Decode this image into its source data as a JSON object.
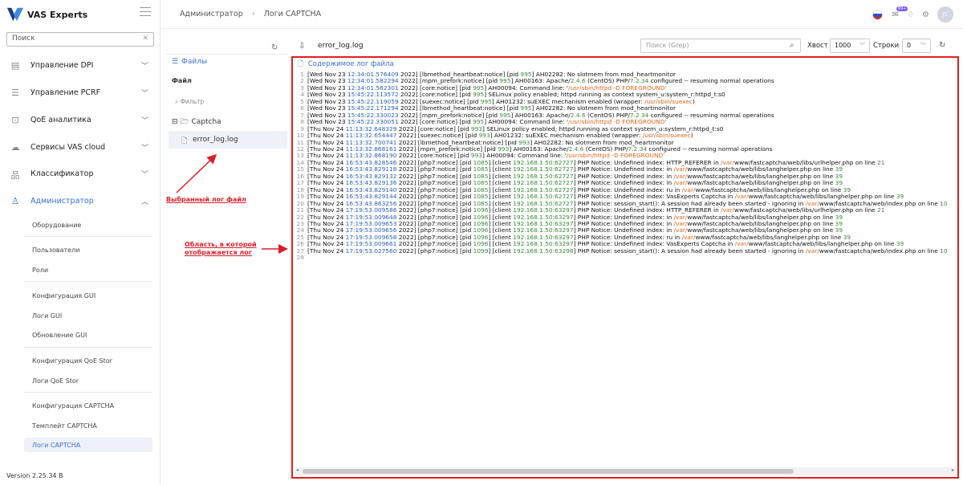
{
  "brand": {
    "name": "VAS Experts"
  },
  "search": {
    "placeholder": "Поиск"
  },
  "sidebar": {
    "items": [
      {
        "label": "Управление DPI"
      },
      {
        "label": "Управление PCRF"
      },
      {
        "label": "QoE аналитика"
      },
      {
        "label": "Сервисы VAS cloud"
      },
      {
        "label": "Классификатор"
      },
      {
        "label": "Администратор"
      }
    ],
    "admin_sub": [
      {
        "label": "Оборудование"
      },
      {
        "label": "Пользователи"
      },
      {
        "label": "Роли"
      },
      {
        "label": "Конфигурация GUI"
      },
      {
        "label": "Логи GUI"
      },
      {
        "label": "Обновление GUI"
      },
      {
        "label": "Конфигурация QoE Stor"
      },
      {
        "label": "Логи QoE Stor"
      },
      {
        "label": "Конфигурация CAPTCHA"
      },
      {
        "label": "Темплейт CAPTCHA"
      },
      {
        "label": "Логи CAPTCHA"
      }
    ],
    "version": "Version 2.25.34 B"
  },
  "header": {
    "breadcrumb": [
      "Администратор",
      "Логи CAPTCHA"
    ],
    "notif_badge": "99+",
    "avatar": "JS",
    "accent": "#3b6fd6"
  },
  "files": {
    "title": "Файлы",
    "file_label": "Файл",
    "filter_placeholder": "Фильтр",
    "folder": "Captcha",
    "file": "error_log.log"
  },
  "annotations": {
    "selected": "Выбранный лог файл",
    "area": "Область, в которой отображается лог"
  },
  "toolbar": {
    "filename": "error_log.log",
    "grep_placeholder": "Поиск (Grep)",
    "tail_label": "Хвост",
    "tail_value": "1000",
    "rows_label": "Строки",
    "rows_value": "0"
  },
  "log": {
    "title": "Содержимое лог файла",
    "lines": [
      "[Wed Nov 23 12:34:01.576409 2022] [lbmethod_heartbeat:notice] [pid 995] AH02282: No slotmem from mod_heartmonitor",
      "[Wed Nov 23 12:34:01.582294 2022] [mpm_prefork:notice] [pid 995] AH00163: Apache/2.4.6 (CentOS) PHP/7.2.34 configured -- resuming normal operations",
      "[Wed Nov 23 12:34:01.582301 2022] [core:notice] [pid 995] AH00094: Command line: '/usr/sbin/httpd -D FOREGROUND'",
      "[Wed Nov 23 15:45:22.113572 2022] [core:notice] [pid 995] SELinux policy enabled; httpd running as context system_u:system_r:httpd_t:s0",
      "[Wed Nov 23 15:45:22.119059 2022] [suexec:notice] [pid 995] AH01232: suEXEC mechanism enabled (wrapper: /usr/sbin/suexec)",
      "[Wed Nov 23 15:45:22.171294 2022] [lbmethod_heartbeat:notice] [pid 995] AH02282: No slotmem from mod_heartmonitor",
      "[Wed Nov 23 15:45:22.330023 2022] [mpm_prefork:notice] [pid 995] AH00163: Apache/2.4.6 (CentOS) PHP/7.2.34 configured -- resuming normal operations",
      "[Wed Nov 23 15:45:22.330051 2022] [core:notice] [pid 995] AH00094: Command line: '/usr/sbin/httpd -D FOREGROUND'",
      "[Thu Nov 24 11:13:32.648329 2022] [core:notice] [pid 993] SELinux policy enabled; httpd running as context system_u:system_r:httpd_t:s0",
      "[Thu Nov 24 11:13:32.654447 2022] [suexec:notice] [pid 993] AH01232: suEXEC mechanism enabled (wrapper: /usr/sbin/suexec)",
      "[Thu Nov 24 11:13:32.700741 2022] [lbmethod_heartbeat:notice] [pid 993] AH02282: No slotmem from mod_heartmonitor",
      "[Thu Nov 24 11:13:32.868161 2022] [mpm_prefork:notice] [pid 993] AH00163: Apache/2.4.6 (CentOS) PHP/7.2.34 configured -- resuming normal operations",
      "[Thu Nov 24 11:13:32.868190 2022] [core:notice] [pid 993] AH00094: Command line: '/usr/sbin/httpd -D FOREGROUND'",
      "[Thu Nov 24 16:53:43.828546 2022] [php7:notice] [pid 1085] [client 192.168.1.50:62727] PHP Notice:  Undefined index: HTTP_REFERER in /var/www/fastcaptcha/web/libs/urlhelper.php on line 21",
      "[Thu Nov 24 16:53:43.829118 2022] [php7:notice] [pid 1085] [client 192.168.1.50:62727] PHP Notice:  Undefined index:  in /var/www/fastcaptcha/web/libs/langhelper.php on line 39",
      "[Thu Nov 24 16:53:43.829132 2022] [php7:notice] [pid 1085] [client 192.168.1.50:62727] PHP Notice:  Undefined index:  in /var/www/fastcaptcha/web/libs/langhelper.php on line 39",
      "[Thu Nov 24 16:53:43.829136 2022] [php7:notice] [pid 1085] [client 192.168.1.50:62727] PHP Notice:  Undefined index:  in /var/www/fastcaptcha/web/libs/langhelper.php on line 39",
      "[Thu Nov 24 16:53:43.829140 2022] [php7:notice] [pid 1085] [client 192.168.1.50:62727] PHP Notice:  Undefined index: ru in /var/www/fastcaptcha/web/libs/langhelper.php on line 39",
      "[Thu Nov 24 16:53:43.829144 2022] [php7:notice] [pid 1085] [client 192.168.1.50:62727] PHP Notice:  Undefined index: VasExperts Captcha in /var/www/fastcaptcha/web/libs/langhelper.php on line 39",
      "[Thu Nov 24 16:53:43.863256 2022] [php7:notice] [pid 1085] [client 192.168.1.50:62727] PHP Notice:  session_start(): A session had already been started - ignoring in /var/www/fastcaptcha/web/index.php on line 10",
      "[Thu Nov 24 17:19:53.009586 2022] [php7:notice] [pid 1096] [client 192.168.1.50:63297] PHP Notice:  Undefined index: HTTP_REFERER in /var/www/fastcaptcha/web/libs/urlhelper.php on line 21",
      "[Thu Nov 24 17:19:53.009648 2022] [php7:notice] [pid 1096] [client 192.168.1.50:63297] PHP Notice:  Undefined index:  in /var/www/fastcaptcha/web/libs/langhelper.php on line 39",
      "[Thu Nov 24 17:19:53.009653 2022] [php7:notice] [pid 1096] [client 192.168.1.50:63297] PHP Notice:  Undefined index:  in /var/www/fastcaptcha/web/libs/langhelper.php on line 39",
      "[Thu Nov 24 17:19:53.009656 2022] [php7:notice] [pid 1096] [client 192.168.1.50:63297] PHP Notice:  Undefined index:  in /var/www/fastcaptcha/web/libs/langhelper.php on line 39",
      "[Thu Nov 24 17:19:53.009658 2022] [php7:notice] [pid 1096] [client 192.168.1.50:63297] PHP Notice:  Undefined index: ru in /var/www/fastcaptcha/web/libs/langhelper.php on line 39",
      "[Thu Nov 24 17:19:53.009661 2022] [php7:notice] [pid 1096] [client 192.168.1.50:63297] PHP Notice:  Undefined index: VasExperts Captcha in /var/www/fastcaptcha/web/libs/langhelper.php on line 39",
      "[Thu Nov 24 17:19:53.027560 2022] [php7:notice] [pid 1099] [client 192.168.1.50:63298] PHP Notice:  session_start(): A session had already been started - ignoring in /var/www/fastcaptcha/web/index.php on line 10",
      ""
    ]
  }
}
